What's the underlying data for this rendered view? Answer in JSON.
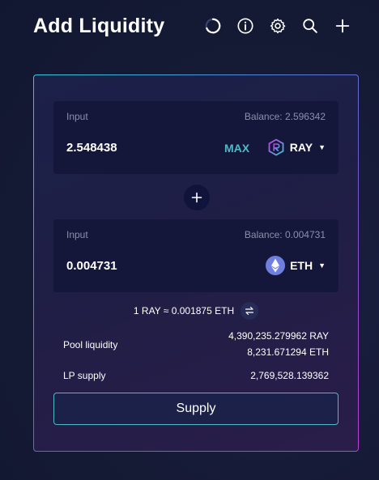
{
  "header": {
    "title": "Add Liquidity",
    "icons": [
      "refresh-timer-icon",
      "info-icon",
      "settings-icon",
      "search-icon",
      "plus-icon"
    ]
  },
  "input_a": {
    "label": "Input",
    "balance": "Balance: 2.596342",
    "amount": "2.548438",
    "max_label": "MAX",
    "token": "RAY",
    "token_icon": "ray-token-icon"
  },
  "input_b": {
    "label": "Input",
    "balance": "Balance: 0.004731",
    "amount": "0.004731",
    "token": "ETH",
    "token_icon": "eth-token-icon"
  },
  "rate": "1 RAY ≈ 0.001875 ETH",
  "pool": {
    "liquidity_label": "Pool liquidity",
    "liquidity_ray": "4,390,235.279962 RAY",
    "liquidity_eth": "8,231.671294 ETH",
    "lp_supply_label": "LP supply",
    "lp_supply_value": "2,769,528.139362"
  },
  "supply_label": "Supply",
  "colors": {
    "accent": "#4fb9c8",
    "background": "#141a33",
    "card_border_start": "#39c6d8",
    "card_border_end": "#c03dd8"
  }
}
